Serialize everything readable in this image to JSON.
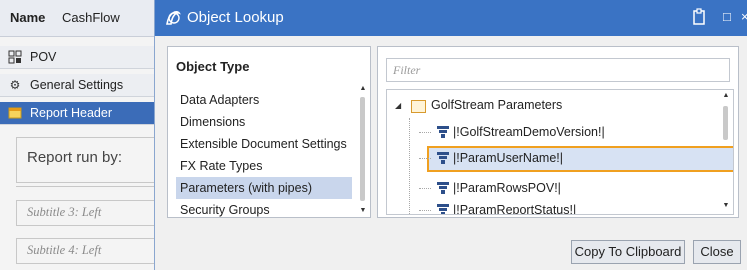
{
  "left_panel": {
    "name_label": "Name",
    "name_value": "CashFlow",
    "nav": [
      {
        "label": "POV",
        "icon": "pov-icon"
      },
      {
        "label": "General Settings",
        "icon": "gear-icon"
      },
      {
        "label": "Report Header",
        "icon": "report-header-icon",
        "selected": true
      }
    ],
    "report_run_by": "Report run by:",
    "subtitle3_placeholder": "Subtitle 3: Left",
    "subtitle4_placeholder": "Subtitle 4: Left"
  },
  "dialog": {
    "title": "Object Lookup",
    "controls": {
      "restore": "□",
      "close": "×"
    },
    "object_type_header": "Object Type",
    "object_types": [
      "Data Adapters",
      "Dimensions",
      "Extensible Document Settings",
      "FX Rate Types",
      "Parameters (with pipes)",
      "Security Groups"
    ],
    "selected_object_type": "Parameters (with pipes)",
    "filter_placeholder": "Filter",
    "tree": {
      "root": "GolfStream Parameters",
      "items": [
        "|!GolfStreamDemoVersion!|",
        "|!ParamUserName!|",
        "|!ParamRowsPOV!|",
        "|!ParamReportStatus!|"
      ],
      "selected": "|!ParamUserName!|"
    },
    "buttons": {
      "copy": "Copy To Clipboard",
      "close": "Close"
    }
  },
  "colors": {
    "title_bar": "#3a73c4",
    "selected_nav": "#3b6cb8",
    "selection_highlight": "#c9d6ec",
    "selected_tree_outline": "#f0a020"
  }
}
